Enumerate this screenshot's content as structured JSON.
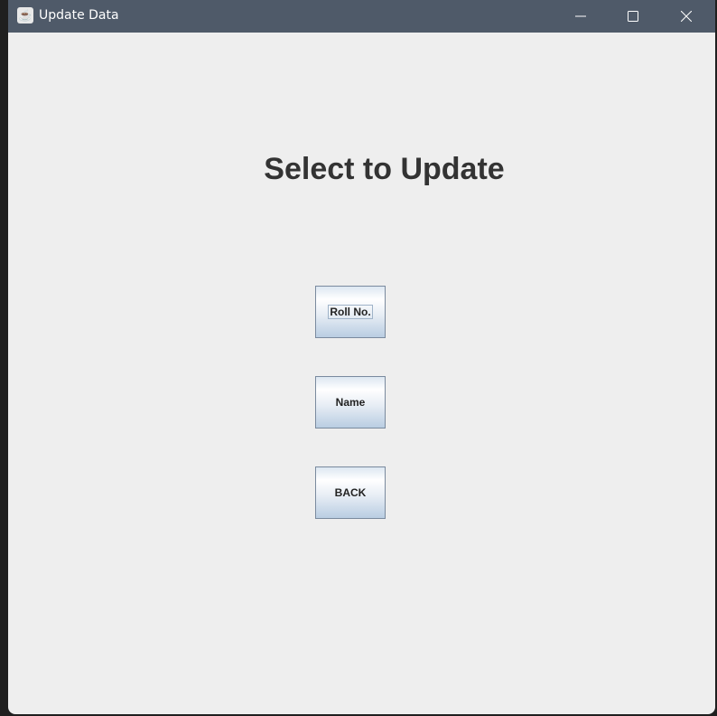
{
  "window": {
    "title": "Update Data"
  },
  "main": {
    "heading": "Select to Update",
    "buttons": {
      "roll_no": "Roll No.",
      "name": "Name",
      "back": "BACK"
    }
  }
}
